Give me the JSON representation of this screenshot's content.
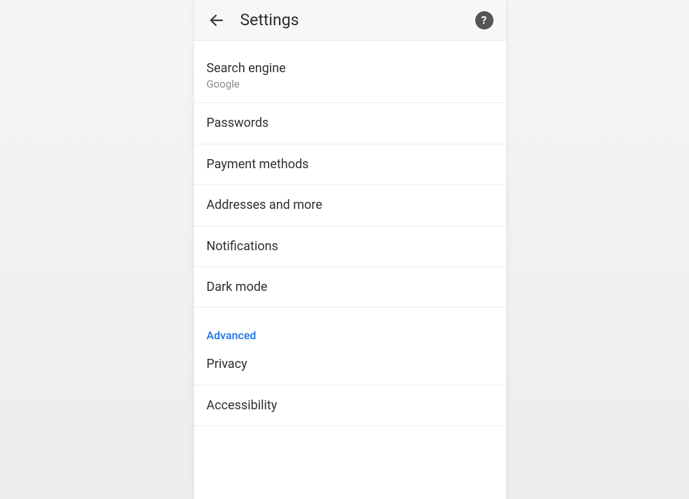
{
  "header": {
    "title": "Settings"
  },
  "basics": {
    "items": [
      {
        "label": "Search engine",
        "sub": "Google"
      },
      {
        "label": "Passwords"
      },
      {
        "label": "Payment methods"
      },
      {
        "label": "Addresses and more"
      },
      {
        "label": "Notifications"
      },
      {
        "label": "Dark mode"
      }
    ]
  },
  "advanced": {
    "section_label": "Advanced",
    "items": [
      {
        "label": "Privacy"
      },
      {
        "label": "Accessibility"
      }
    ]
  }
}
